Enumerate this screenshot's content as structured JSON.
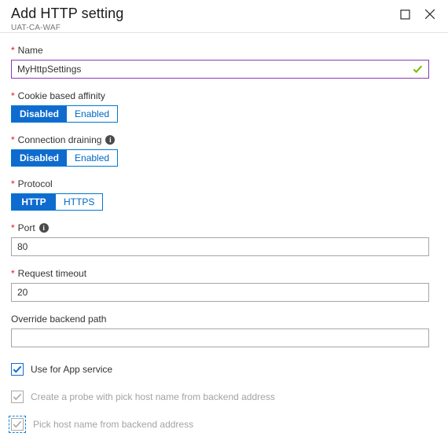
{
  "header": {
    "title": "Add HTTP setting",
    "subtitle": "UAT-CA-WAF",
    "maximize_label": "Maximize",
    "close_label": "Close"
  },
  "form": {
    "name": {
      "label": "Name",
      "required": true,
      "value": "MyHttpSettings",
      "placeholder": "",
      "valid": true,
      "validation_icon": "green-check-icon",
      "border_color": "#873bb4"
    },
    "cookie_affinity": {
      "label": "Cookie based affinity",
      "required": true,
      "options": [
        "Disabled",
        "Enabled"
      ],
      "selected": "Disabled"
    },
    "connection_draining": {
      "label": "Connection draining",
      "required": true,
      "info": "i",
      "options": [
        "Disabled",
        "Enabled"
      ],
      "selected": "Disabled"
    },
    "protocol": {
      "label": "Protocol",
      "required": true,
      "options": [
        "HTTP",
        "HTTPS"
      ],
      "selected": "HTTP"
    },
    "port": {
      "label": "Port",
      "required": true,
      "info": "i",
      "value": "80",
      "placeholder": ""
    },
    "request_timeout": {
      "label": "Request timeout",
      "required": true,
      "value": "20",
      "placeholder": ""
    },
    "override_backend_path": {
      "label": "Override backend path",
      "required": false,
      "value": "",
      "placeholder": ""
    },
    "checkboxes": [
      {
        "label": "Use for App service",
        "checked": true,
        "disabled": false,
        "focused": false
      },
      {
        "label": "Create a probe with pick host name from backend address",
        "checked": true,
        "disabled": true,
        "focused": false
      },
      {
        "label": "Pick host name from backend address",
        "checked": true,
        "disabled": true,
        "focused": true
      }
    ]
  },
  "colors": {
    "accent_blue": "#0f6cce",
    "link_blue": "#0067c0",
    "required_red": "#e81123",
    "valid_purple": "#873bb4",
    "valid_green": "#7ab800",
    "disabled_gray": "#a3a3a3"
  }
}
